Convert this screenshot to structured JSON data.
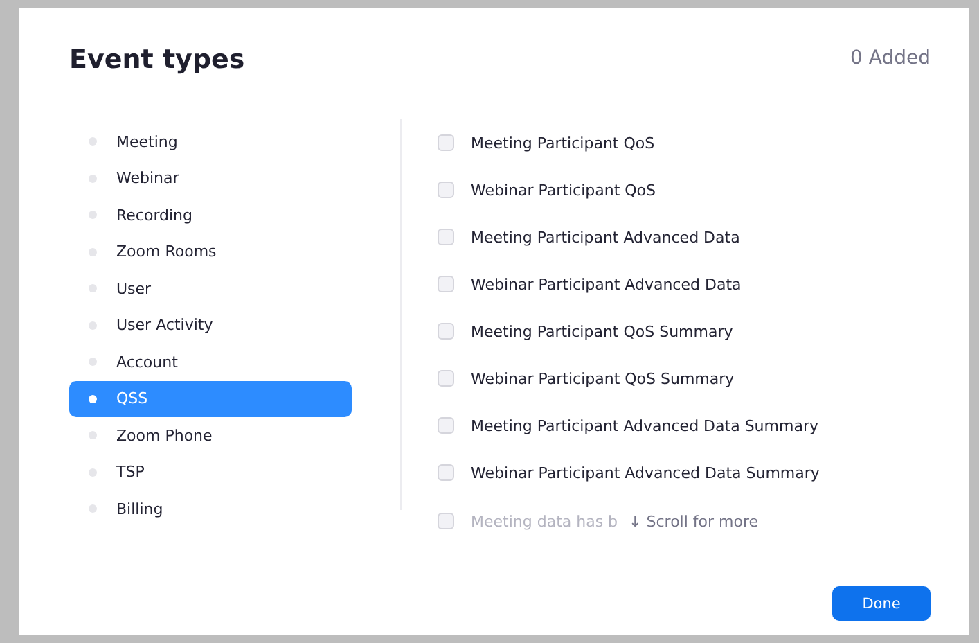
{
  "title": "Event types",
  "added_count": "0 Added",
  "categories": [
    {
      "label": "Meeting",
      "selected": false
    },
    {
      "label": "Webinar",
      "selected": false
    },
    {
      "label": "Recording",
      "selected": false
    },
    {
      "label": "Zoom Rooms",
      "selected": false
    },
    {
      "label": "User",
      "selected": false
    },
    {
      "label": "User Activity",
      "selected": false
    },
    {
      "label": "Account",
      "selected": false
    },
    {
      "label": "QSS",
      "selected": true
    },
    {
      "label": "Zoom Phone",
      "selected": false
    },
    {
      "label": "TSP",
      "selected": false
    },
    {
      "label": "Billing",
      "selected": false
    }
  ],
  "events": [
    {
      "label": "Meeting Participant QoS",
      "checked": false
    },
    {
      "label": "Webinar Participant QoS",
      "checked": false
    },
    {
      "label": "Meeting Participant Advanced Data",
      "checked": false
    },
    {
      "label": "Webinar Participant Advanced Data",
      "checked": false
    },
    {
      "label": "Meeting Participant QoS Summary",
      "checked": false
    },
    {
      "label": "Webinar Participant QoS Summary",
      "checked": false
    },
    {
      "label": "Meeting Participant Advanced Data Summary",
      "checked": false
    },
    {
      "label": "Webinar Participant Advanced Data Summary",
      "checked": false
    }
  ],
  "faded_event": {
    "label": "Meeting data has b",
    "checked": false
  },
  "scroll_hint": "↓ Scroll for more",
  "done_button": "Done"
}
